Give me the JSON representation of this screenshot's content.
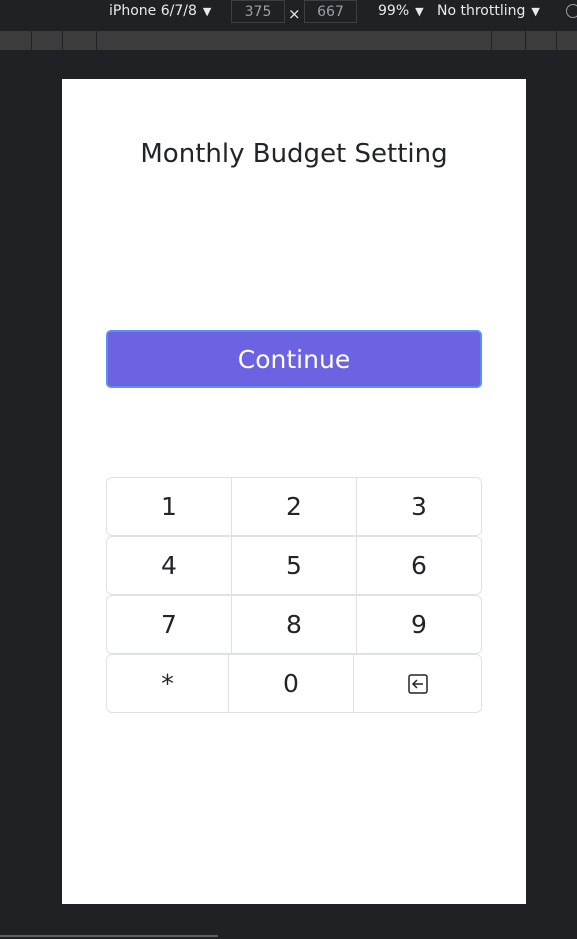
{
  "devtools": {
    "device": "iPhone 6/7/8",
    "width": "375",
    "times": "×",
    "height": "667",
    "zoom": "99%",
    "throttling": "No throttling",
    "caret": "▼"
  },
  "page": {
    "title": "Monthly Budget Setting",
    "continue_label": "Continue"
  },
  "keypad": {
    "rows": [
      [
        "1",
        "2",
        "3"
      ],
      [
        "4",
        "5",
        "6"
      ],
      [
        "7",
        "8",
        "9"
      ],
      [
        "*",
        "0",
        "backspace-icon"
      ]
    ]
  },
  "colors": {
    "primary": "#6c63e3",
    "primary_border": "#5b8ef0",
    "background": "#202124"
  }
}
